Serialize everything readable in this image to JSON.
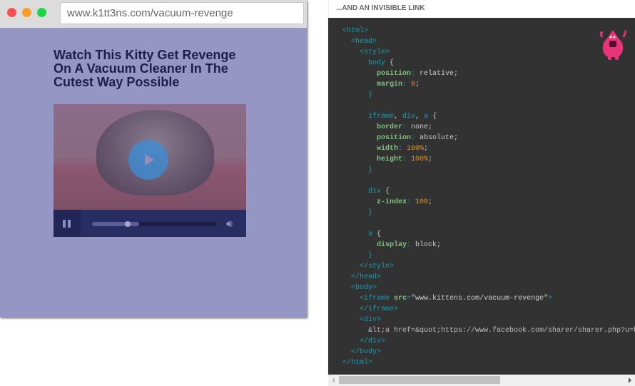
{
  "browser": {
    "url": "www.k1tt3ns.com/vacuum-revenge",
    "headline": "Watch This Kitty Get Revenge On A Vacuum Cleaner In The Cutest Way Possible",
    "video": {
      "progress": 0.29,
      "buffered": 0.38,
      "volume_icon": "speaker-icon",
      "play_icon": "play-icon",
      "pause_icon": "pause-icon"
    }
  },
  "panel": {
    "title": "...AND AN INVISIBLE LINK"
  },
  "code": {
    "lines": [
      [
        [
          0,
          "tag",
          "<html>"
        ]
      ],
      [
        [
          1,
          "tag",
          "<head>"
        ]
      ],
      [
        [
          2,
          "tag",
          "<style>"
        ]
      ],
      [
        [
          3,
          "tag",
          "body"
        ],
        [
          0,
          "val",
          " {"
        ]
      ],
      [
        [
          4,
          "prop",
          "position"
        ],
        [
          0,
          "punc",
          ": "
        ],
        [
          0,
          "val",
          "relative;"
        ]
      ],
      [
        [
          4,
          "prop",
          "margin"
        ],
        [
          0,
          "punc",
          ": "
        ],
        [
          0,
          "num",
          "0"
        ],
        [
          0,
          "val",
          ";"
        ]
      ],
      [
        [
          3,
          "punc",
          "}"
        ]
      ],
      [],
      [
        [
          3,
          "tag",
          "iframe"
        ],
        [
          0,
          "val",
          ", "
        ],
        [
          0,
          "tag",
          "div"
        ],
        [
          0,
          "val",
          ", "
        ],
        [
          0,
          "tag",
          "a"
        ],
        [
          0,
          "val",
          " {"
        ]
      ],
      [
        [
          4,
          "prop",
          "border"
        ],
        [
          0,
          "punc",
          ": "
        ],
        [
          0,
          "val",
          "none;"
        ]
      ],
      [
        [
          4,
          "prop",
          "position"
        ],
        [
          0,
          "punc",
          ": "
        ],
        [
          0,
          "val",
          "absolute;"
        ]
      ],
      [
        [
          4,
          "prop",
          "width"
        ],
        [
          0,
          "punc",
          ": "
        ],
        [
          0,
          "num",
          "100%"
        ],
        [
          0,
          "val",
          ";"
        ]
      ],
      [
        [
          4,
          "prop",
          "height"
        ],
        [
          0,
          "punc",
          ": "
        ],
        [
          0,
          "num",
          "100%"
        ],
        [
          0,
          "val",
          ";"
        ]
      ],
      [
        [
          3,
          "punc",
          "}"
        ]
      ],
      [],
      [
        [
          3,
          "tag",
          "div"
        ],
        [
          0,
          "val",
          " {"
        ]
      ],
      [
        [
          4,
          "prop",
          "z-index"
        ],
        [
          0,
          "punc",
          ": "
        ],
        [
          0,
          "num",
          "100"
        ],
        [
          0,
          "val",
          ";"
        ]
      ],
      [
        [
          3,
          "punc",
          "}"
        ]
      ],
      [],
      [
        [
          3,
          "tag",
          "a"
        ],
        [
          0,
          "val",
          " {"
        ]
      ],
      [
        [
          4,
          "prop",
          "display"
        ],
        [
          0,
          "punc",
          ": "
        ],
        [
          0,
          "val",
          "block;"
        ]
      ],
      [
        [
          3,
          "punc",
          "}"
        ]
      ],
      [
        [
          2,
          "tag",
          "</style>"
        ]
      ],
      [
        [
          1,
          "tag",
          "</head>"
        ]
      ],
      [
        [
          1,
          "tag",
          "<body>"
        ]
      ],
      [
        [
          2,
          "tag",
          "<iframe "
        ],
        [
          0,
          "prop",
          "src"
        ],
        [
          0,
          "tag",
          "="
        ],
        [
          0,
          "val",
          "\"www.kittens.com/vacuum-revenge\""
        ],
        [
          0,
          "tag",
          ">"
        ]
      ],
      [
        [
          2,
          "tag",
          "</iframe>"
        ]
      ],
      [
        [
          2,
          "tag",
          "<div>"
        ]
      ],
      [
        [
          3,
          "txt",
          "&lt;a href=&quot;https://www.facebook.com/sharer/sharer.php?u=h"
        ]
      ],
      [
        [
          2,
          "tag",
          "</div>"
        ]
      ],
      [
        [
          1,
          "tag",
          "</body>"
        ]
      ],
      [
        [
          0,
          "tag",
          "</html>"
        ]
      ]
    ]
  },
  "colors": {
    "close": "#fc4f55",
    "minimize": "#fd9f27",
    "maximize": "#20d545",
    "overlay": "#9696c4",
    "code_bg": "#323232",
    "monster": "#e8357a"
  }
}
